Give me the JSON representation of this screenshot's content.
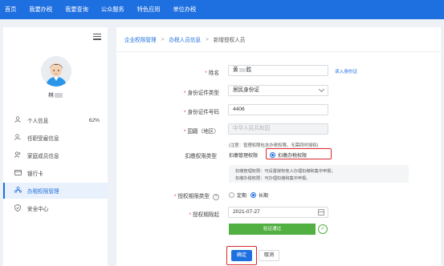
{
  "topnav": {
    "items": [
      "首页",
      "我要办税",
      "我要查询",
      "公众服务",
      "特色应用",
      "单位办税"
    ]
  },
  "sidebar": {
    "user_name": "林",
    "items": [
      {
        "label": "个人信息",
        "icon": "person-icon",
        "extra": "62%"
      },
      {
        "label": "任职受雇信息",
        "icon": "person-icon"
      },
      {
        "label": "家庭成员信息",
        "icon": "family-icon"
      },
      {
        "label": "银行卡",
        "icon": "card-icon"
      },
      {
        "label": "办税权限管理",
        "icon": "org-icon",
        "active": true
      },
      {
        "label": "安全中心",
        "icon": "shield-icon"
      }
    ]
  },
  "breadcrumb": {
    "items": [
      "企业权限管理",
      "办税人员信息"
    ],
    "current": "新增授权人员"
  },
  "form": {
    "name_label": "姓名",
    "name_value": "黄",
    "name_value_suffix": "胜",
    "import_link": "读入身份证",
    "id_type_label": "身份证件类型",
    "id_type_value": "居民身份证",
    "id_number_label": "身份证件号码",
    "id_number_value": "4406",
    "nationality_label": "国籍（地区）",
    "nationality_value": "中华人民共和国",
    "auth_type_label": "扣缴权限类型",
    "auth_note": "(注意：管理权限包含办税权限，无需同时授权)",
    "auth_options": [
      "扣缴管理权限",
      "扣缴办税权限"
    ],
    "auth_desc_1": "扣缴管理权限：可设置授权他人办理扣缴和集中申报；",
    "auth_desc_2": "扣缴办税权限：可办理扣缴和集中申报。",
    "term_type_label": "授权期限类型",
    "term_options": [
      "定期",
      "长期"
    ],
    "start_date_label": "授权期限起",
    "start_date_value": "2021-07-27",
    "verify_text": "验证通过",
    "confirm_label": "确定",
    "cancel_label": "取消"
  },
  "colors": {
    "primary": "#1e6fe0",
    "success": "#52b043",
    "highlight": "#d9262b",
    "required": "#e03a3a"
  }
}
